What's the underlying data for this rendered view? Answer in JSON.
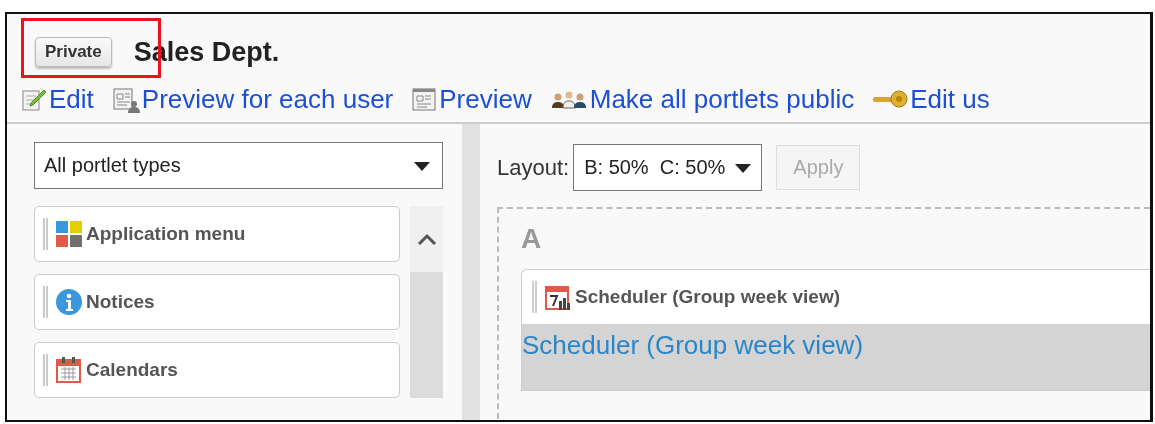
{
  "header": {
    "visibility_button": "Private",
    "title": "Sales Dept."
  },
  "actions": [
    {
      "kind": "edit",
      "label": "Edit"
    },
    {
      "kind": "preview_user",
      "label": "Preview for each user"
    },
    {
      "kind": "preview",
      "label": "Preview"
    },
    {
      "kind": "public",
      "label": "Make all portlets public"
    },
    {
      "kind": "key",
      "label": "Edit us"
    }
  ],
  "highlight": {
    "visible": true
  },
  "sidebar": {
    "filter": {
      "value": "All portlet types"
    },
    "items": [
      {
        "kind": "apps",
        "label": "Application menu"
      },
      {
        "kind": "info",
        "label": "Notices"
      },
      {
        "kind": "calendar",
        "label": "Calendars"
      }
    ]
  },
  "layout": {
    "label": "Layout:",
    "value": "B: 50%  C: 50%",
    "apply": {
      "label": "Apply",
      "disabled": true
    }
  },
  "area": {
    "label": "A",
    "portlets": [
      {
        "title": "Scheduler (Group week view)",
        "link": "Scheduler (Group week view)"
      }
    ]
  }
}
